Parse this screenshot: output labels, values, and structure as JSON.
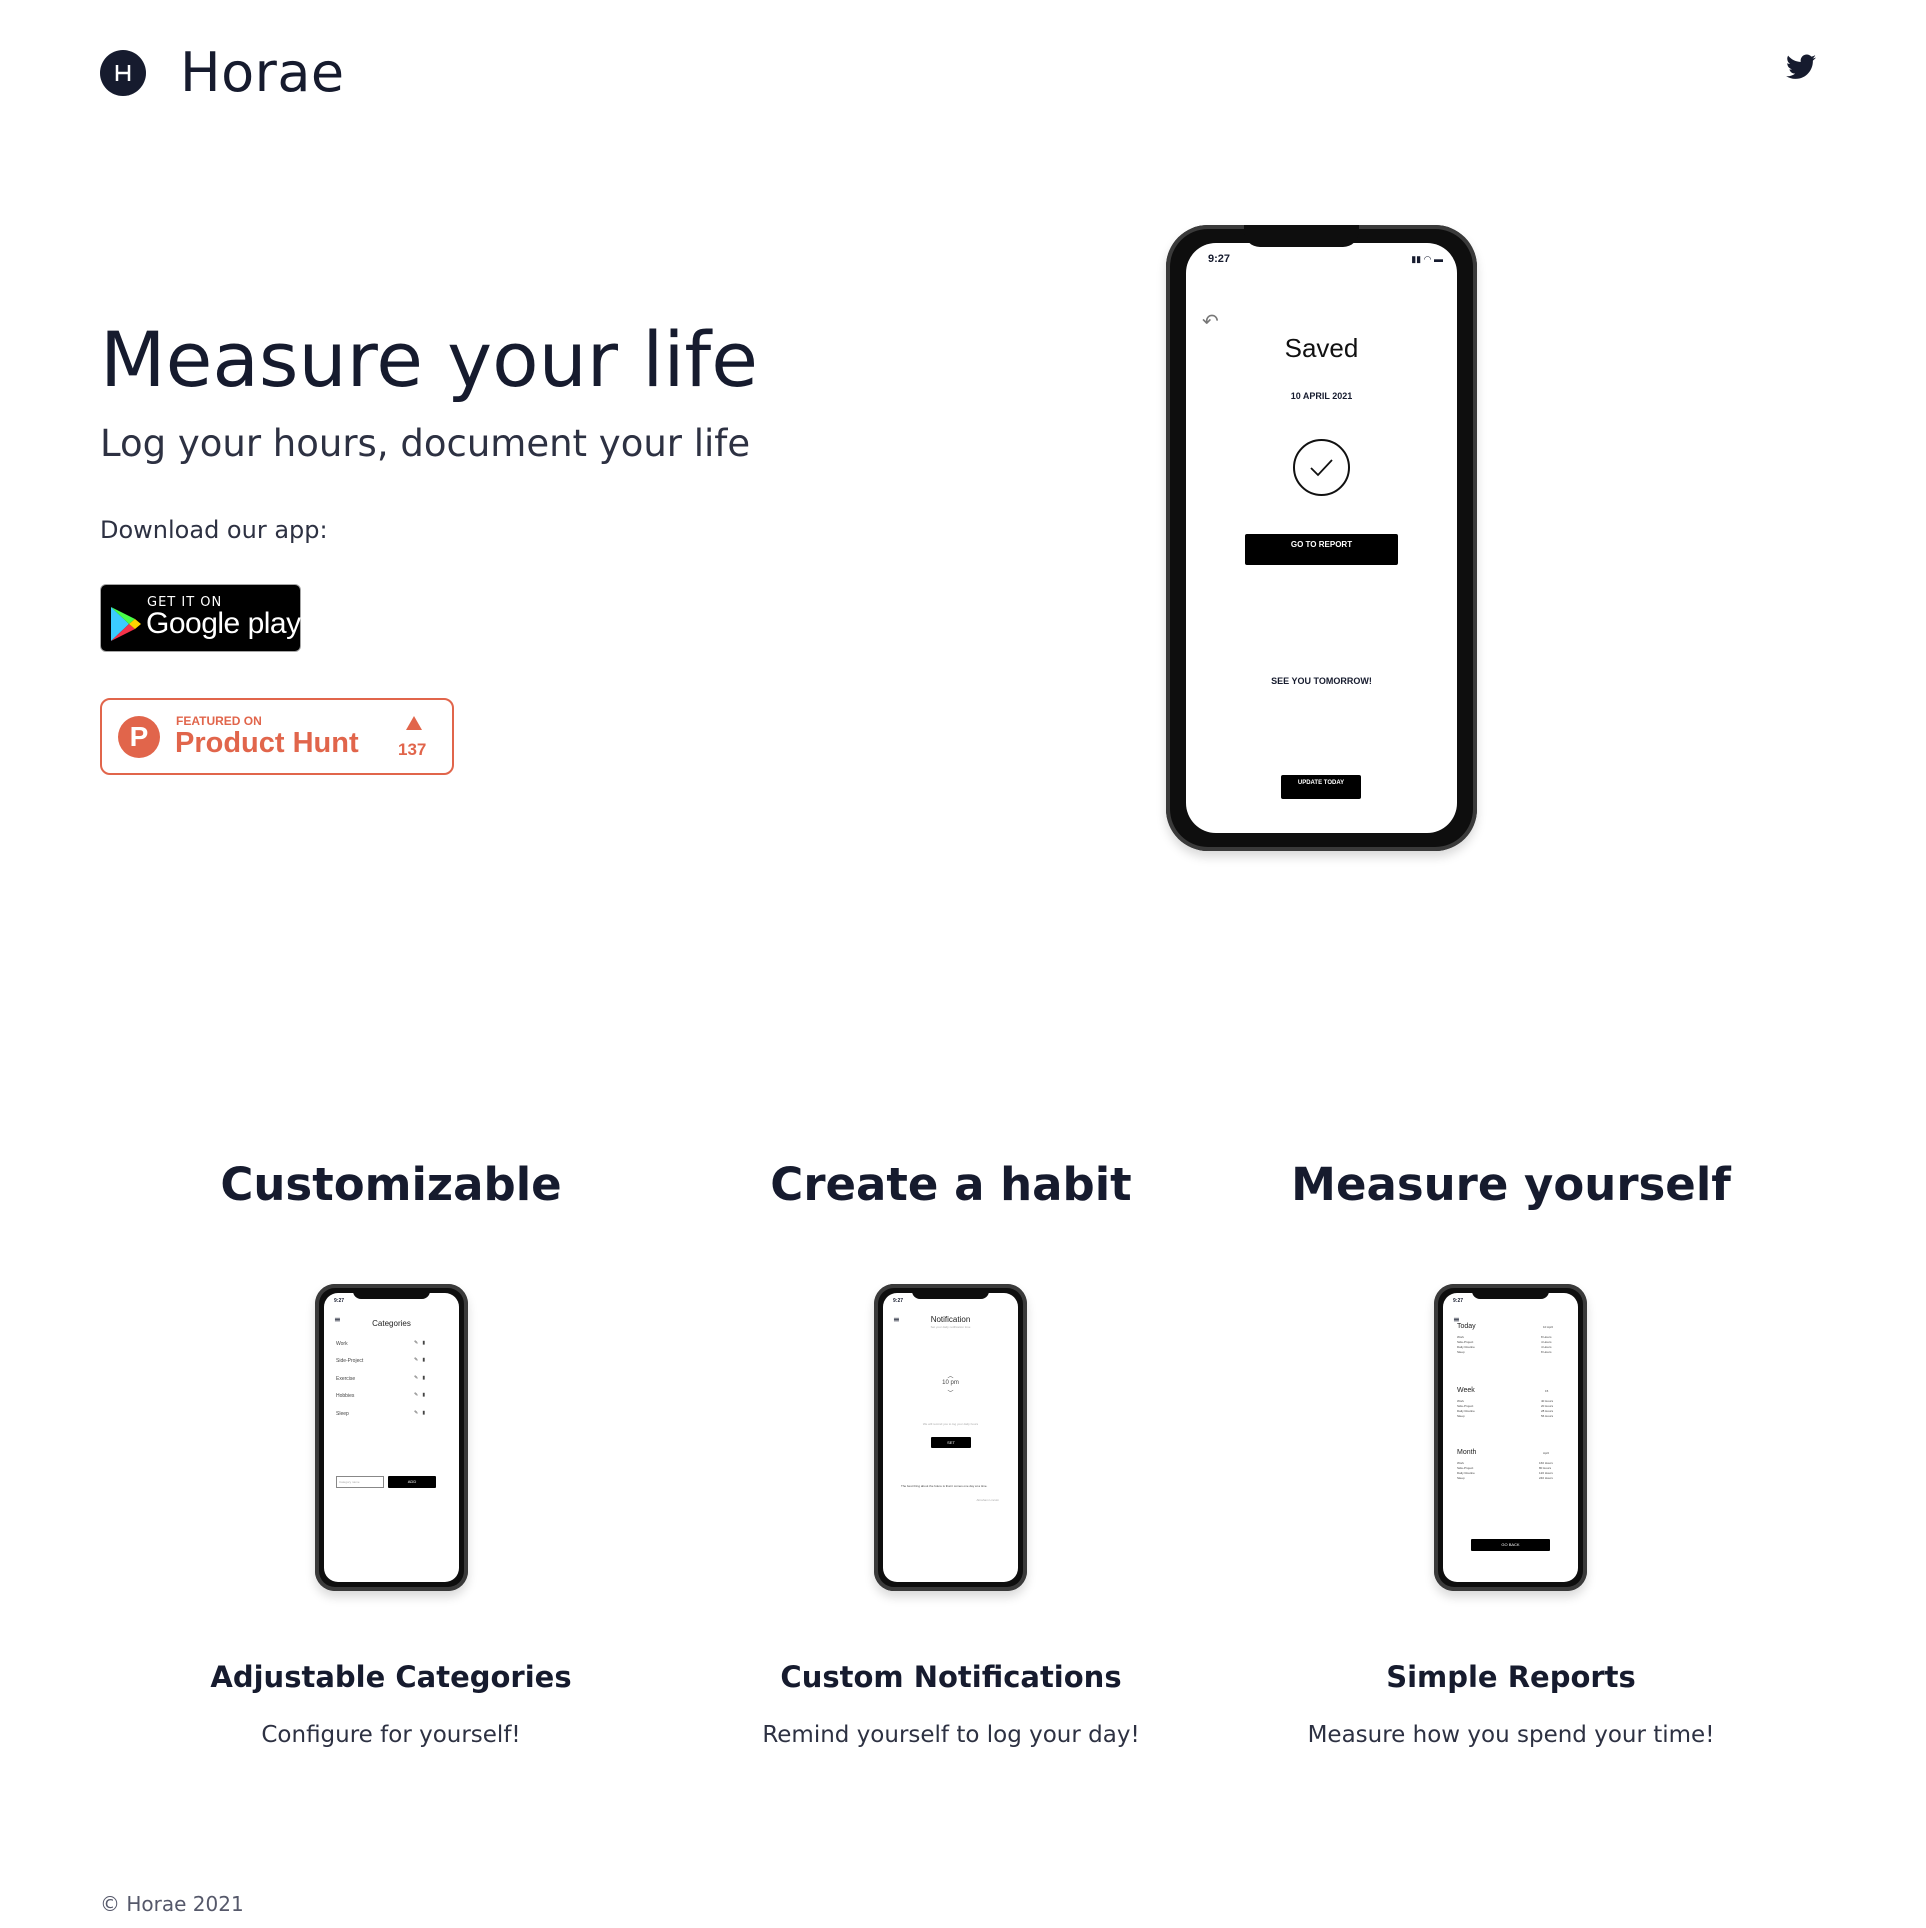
{
  "header": {
    "brand": "Horae",
    "logo_icon": "horae-logo-icon",
    "social_icon": "twitter-icon"
  },
  "hero": {
    "title": "Measure your life",
    "subtitle": "Log your hours, document your life",
    "download_label": "Download our app:",
    "google_play": {
      "small": "GET IT ON",
      "big": "Google play"
    },
    "product_hunt": {
      "featured": "FEATURED ON",
      "name": "Product Hunt",
      "count": "137"
    },
    "phone": {
      "time": "9:27",
      "status": "▮▮ ◠ ▬",
      "title": "Saved",
      "date": "10 APRIL 2021",
      "button1": "GO TO REPORT",
      "message": "SEE YOU TOMORROW!",
      "button2": "UPDATE TODAY"
    }
  },
  "features": [
    {
      "title": "Customizable",
      "subtitle": "Adjustable Categories",
      "description": "Configure for yourself!",
      "phone": {
        "time": "9:27",
        "heading": "Categories",
        "items": [
          "Work",
          "Side-Project",
          "Exercise",
          "Hobbies",
          "Sleep"
        ],
        "input_placeholder": "Category name",
        "button": "ADD"
      }
    },
    {
      "title": "Create a habit",
      "subtitle": "Custom Notifications",
      "description": "Remind yourself to log your day!",
      "phone": {
        "time": "9:27",
        "heading": "Notification",
        "caption": "Set your daily notification time",
        "value": "10 pm",
        "note": "We will remind you to log your daily hours",
        "button": "SET",
        "quote": "The best thing about the future is that it comes one day at a time.",
        "quote_author": "Abraham Lincoln"
      }
    },
    {
      "title": "Measure yourself",
      "subtitle": "Simple Reports",
      "description": "Measure how you spend your time!",
      "phone": {
        "time": "9:27",
        "sections": [
          {
            "heading": "Today",
            "tag": "10 April",
            "items": [
              "Work",
              "Side-Project",
              "Daily Routine",
              "Sleep"
            ],
            "values": [
              "8 Hours",
              "4 Hours",
              "4 Hours",
              "8 Hours"
            ]
          },
          {
            "heading": "Week",
            "tag": "15",
            "items": [
              "Work",
              "Side-Project",
              "Daily Routine",
              "Sleep"
            ],
            "values": [
              "40 Hours",
              "20 Hours",
              "28 Hours",
              "56 Hours"
            ]
          },
          {
            "heading": "Month",
            "tag": "April",
            "items": [
              "Work",
              "Side-Project",
              "Daily Routine",
              "Sleep"
            ],
            "values": [
              "160 Hours",
              "80 Hours",
              "120 Hours",
              "240 Hours"
            ]
          }
        ],
        "button": "GO BACK"
      }
    }
  ],
  "footer": {
    "copyright": "© Horae 2021"
  }
}
